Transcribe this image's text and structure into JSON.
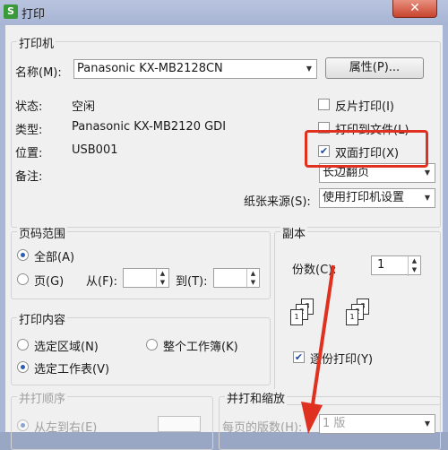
{
  "window": {
    "title": "打印",
    "app_icon": "S",
    "close_label": "✕"
  },
  "printer": {
    "group_title": "打印机",
    "name_label": "名称(M):",
    "name_value": "Panasonic KX-MB2128CN",
    "properties_button": "属性(P)...",
    "status_label": "状态:",
    "status_value": "空闲",
    "type_label": "类型:",
    "type_value": "Panasonic KX-MB2120 GDI",
    "location_label": "位置:",
    "location_value": "USB001",
    "comment_label": "备注:",
    "reverse_print": "反片打印(I)",
    "print_to_file": "打印到文件(L)",
    "duplex": "双面打印(X)",
    "duplex_mode": "长边翻页",
    "paper_source_label": "纸张来源(S):",
    "paper_source_value": "使用打印机设置"
  },
  "page_range": {
    "group_title": "页码范围",
    "all": "全部(A)",
    "pages": "页(G)",
    "from_label": "从(F):",
    "to_label": "到(T):"
  },
  "copies": {
    "group_title": "副本",
    "count_label": "份数(C):",
    "count_value": "1",
    "collate": "逐份打印(Y)"
  },
  "print_content": {
    "group_title": "打印内容",
    "selection": "选定区域(N)",
    "workbook": "整个工作簿(K)",
    "sheet": "选定工作表(V)"
  },
  "print_order": {
    "group_title": "并打顺序",
    "left_to_right": "从左到右(E)"
  },
  "merge_scale": {
    "group_title": "并打和缩放",
    "pages_per_sheet_label": "每页的版数(H):",
    "pages_per_sheet_value": "1 版"
  }
}
